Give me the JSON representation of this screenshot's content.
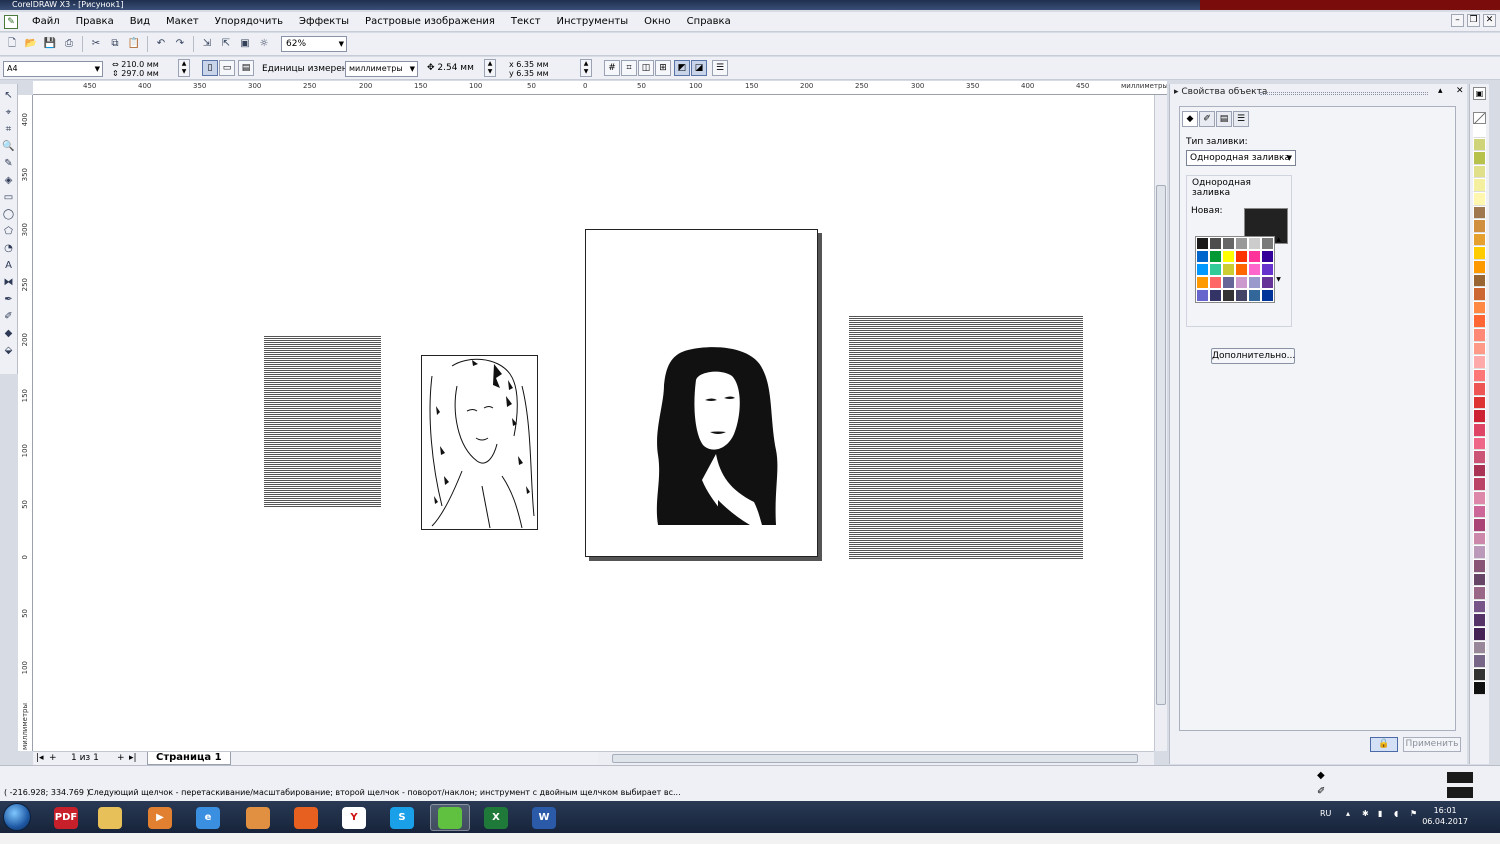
{
  "window": {
    "title": "CorelDRAW X3 - [Рисунок1]"
  },
  "menu": {
    "items": [
      "Файл",
      "Правка",
      "Вид",
      "Макет",
      "Упорядочить",
      "Эффекты",
      "Растровые изображения",
      "Текст",
      "Инструменты",
      "Окно",
      "Справка"
    ]
  },
  "toolbar": {
    "zoom": "62%"
  },
  "property_bar": {
    "page_size": "A4",
    "width": "210.0 мм",
    "height": "297.0 мм",
    "units_label": "Единицы измерения:",
    "units_value": "миллиметры",
    "nudge": "2.54 мм",
    "dup_x": "6.35 мм",
    "dup_y": "6.35 мм",
    "dup_x_label": "x",
    "dup_y_label": "y"
  },
  "rulers": {
    "horizontal_labels": [
      "450",
      "400",
      "350",
      "300",
      "250",
      "200",
      "150",
      "100",
      "50",
      "0",
      "50",
      "100",
      "150",
      "200",
      "250",
      "300",
      "350",
      "400",
      "450"
    ],
    "horizontal_unit": "миллиметры",
    "vertical_labels": [
      "400",
      "350",
      "300",
      "250",
      "200",
      "150",
      "100",
      "50",
      "0",
      "50",
      "100"
    ],
    "vertical_unit": "миллиметры"
  },
  "page_nav": {
    "first": "|◂",
    "prev_add": "+",
    "page_count": "1 из 1",
    "next_add": "+",
    "last": "▸|",
    "tab_label": "Страница 1"
  },
  "docker": {
    "title": "Свойства объекта",
    "fill_type_label": "Тип заливки:",
    "fill_type_value": "Однородная заливка",
    "group_label": "Однородная заливка",
    "new_label": "Новая:",
    "new_color": "#222222",
    "more_button": "Дополнительно...",
    "apply_button": "Применить",
    "palette": [
      "#1a1a1a",
      "#4d4d4d",
      "#666666",
      "#999999",
      "#cccccc",
      "#7a7a7a",
      "#0066cc",
      "#009933",
      "#ffff00",
      "#ff3300",
      "#ff3399",
      "#330099",
      "#0099ff",
      "#33cc99",
      "#cccc33",
      "#ff6600",
      "#ff66cc",
      "#6633cc",
      "#ff9900",
      "#ff6666",
      "#666699",
      "#cc99cc",
      "#9999cc",
      "#663399",
      "#6666cc",
      "#333366",
      "#333333",
      "#444466",
      "#336699",
      "#003399"
    ]
  },
  "color_palette": [
    "#ffffff",
    "#cfd47a",
    "#b7c24d",
    "#e0e08a",
    "#f5f0a0",
    "#fff7b0",
    "#a07850",
    "#d09040",
    "#e6a030",
    "#ffcc00",
    "#ff9900",
    "#996633",
    "#cc6633",
    "#ff8844",
    "#ff6633",
    "#ff8877",
    "#ff9988",
    "#ffaaaa",
    "#ff7777",
    "#ee5555",
    "#dd3333",
    "#cc2233",
    "#dd4466",
    "#ee6688",
    "#cc5577",
    "#aa3355",
    "#bb4466",
    "#dd88aa",
    "#cc6699",
    "#aa4477",
    "#cc88aa",
    "#bb99bb",
    "#885577",
    "#664466",
    "#996688",
    "#775588",
    "#553366",
    "#442255",
    "#998899",
    "#776688",
    "#333333",
    "#111111"
  ],
  "status": {
    "coords": "( -216.928; 334.769 )",
    "hint": "Следующий щелчок - перетаскивание/масштабирование; второй щелчок - поворот/наклон; инструмент с двойным щелчком выбирает вс..."
  },
  "taskbar": {
    "apps": [
      {
        "name": "pdf",
        "label": "PDF",
        "color": "#c8202a"
      },
      {
        "name": "explorer",
        "label": "",
        "color": "#e8c05a"
      },
      {
        "name": "media",
        "label": "▶",
        "color": "#e08030"
      },
      {
        "name": "ie",
        "label": "e",
        "color": "#3a8fe0"
      },
      {
        "name": "app5",
        "label": "",
        "color": "#e09040"
      },
      {
        "name": "app6",
        "label": "",
        "color": "#e86020"
      },
      {
        "name": "yandex",
        "label": "Y",
        "color": "#ffffff"
      },
      {
        "name": "skype",
        "label": "S",
        "color": "#1aa0e8"
      },
      {
        "name": "corel",
        "label": "",
        "color": "#60c040"
      },
      {
        "name": "excel",
        "label": "X",
        "color": "#1f7a3a"
      },
      {
        "name": "word",
        "label": "W",
        "color": "#2a5aa8"
      }
    ],
    "lang": "RU",
    "time": "16:01",
    "date": "06.04.2017"
  }
}
